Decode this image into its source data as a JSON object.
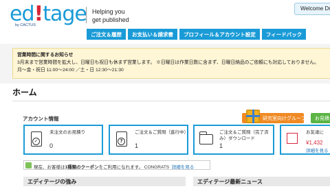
{
  "brand": {
    "logo_text_1": "ed",
    "logo_bang": "!",
    "logo_text_2": "tage",
    "logo_sub": "by CACTUS",
    "tagline_line1": "Helping you",
    "tagline_line2": "get published"
  },
  "header": {
    "welcome_label": "Welcome Dr."
  },
  "nav": {
    "items": [
      {
        "label": "ご注文＆履歴"
      },
      {
        "label": "お支払い＆請求書"
      },
      {
        "label": "プロフィール＆アカウント設定"
      },
      {
        "label": "フィードバック"
      }
    ]
  },
  "notice": {
    "title": "営業時間に関するお知らせ",
    "line1": "3月末まで営業時間を拡大し、日曜日も祝日も休まず営業します。 ※日曜日は作業日数に含まず、日曜日納品のご依頼にも対応しておりません。",
    "line2": "月～金・祝日 11:00～24:00 ／土・日 12:30～21:30"
  },
  "page": {
    "title": "ホーム"
  },
  "account": {
    "title": "アカウント情報",
    "research_btn": "研究室向けグループ",
    "green_btn": "お見積",
    "cards": [
      {
        "label": "未注文のお見積り",
        "value": "0"
      },
      {
        "label": "ご注文＆ご質問（進行中）",
        "value": "1"
      },
      {
        "label_line1": "ご注文＆ご質問（完了済",
        "label_line2": "み）ダウンロード",
        "value": "1"
      },
      {
        "label": "お友達に",
        "value": "¥1,432",
        "link": "詳細を見る"
      }
    ]
  },
  "coupon": {
    "prefix": "現在、お客様は",
    "bold": "1種類のクーポン",
    "middle": "をご利用になれます。 CONGRATS",
    "link": "詳細を見る"
  },
  "sections": {
    "strengths": "エディテージの強み",
    "news": "エディテージ最新ニュース"
  },
  "colors": {
    "brand_blue": "#1a9bd7",
    "brand_red": "#d8263a",
    "orange": "#f08a24",
    "green": "#5bb443"
  }
}
